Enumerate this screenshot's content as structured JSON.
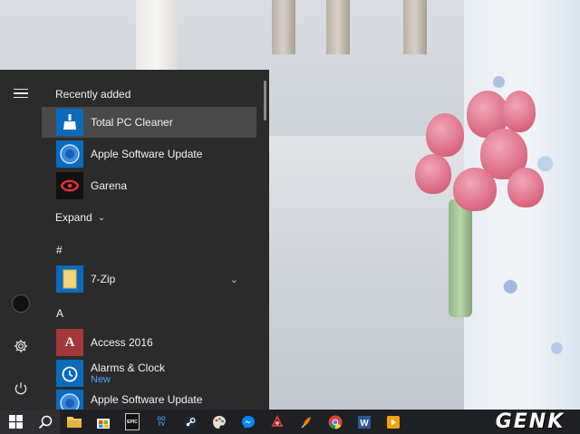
{
  "start_menu": {
    "recently_added_label": "Recently added",
    "recent_apps": [
      {
        "label": "Total PC Cleaner",
        "icon": "broom-icon"
      },
      {
        "label": "Apple Software Update",
        "icon": "apple-update-icon"
      },
      {
        "label": "Garena",
        "icon": "garena-icon"
      }
    ],
    "expand_label": "Expand",
    "groups": [
      {
        "letter": "#",
        "apps": [
          {
            "label": "7-Zip",
            "icon": "folder-icon"
          }
        ]
      },
      {
        "letter": "A",
        "apps": [
          {
            "label": "Access 2016",
            "icon": "access-icon",
            "sub": ""
          },
          {
            "label": "Alarms & Clock",
            "icon": "alarm-clock-icon",
            "sub": "New"
          },
          {
            "label": "Apple Software Update",
            "icon": "apple-update-icon",
            "sub": ""
          }
        ]
      }
    ],
    "rail_icons": [
      "hamburger-icon",
      "avatar",
      "gear-icon",
      "power-icon"
    ]
  },
  "taskbar": {
    "icons": [
      "windows-icon",
      "search-icon",
      "file-explorer-icon",
      "store-icon",
      "epic-games-icon",
      "gotv-icon",
      "steam-icon",
      "paint-icon",
      "messenger-icon",
      "ccleaner-icon",
      "app-icon",
      "chrome-icon",
      "word-icon",
      "media-player-icon"
    ],
    "epic_label": "EPIC",
    "gotv_label": "GO TV"
  },
  "watermark": "GENK",
  "colors": {
    "accent": "#0a6bbd",
    "menu_bg": "#2b2b2b",
    "taskbar_bg": "#1f2023",
    "new_badge": "#4aa3ff"
  }
}
